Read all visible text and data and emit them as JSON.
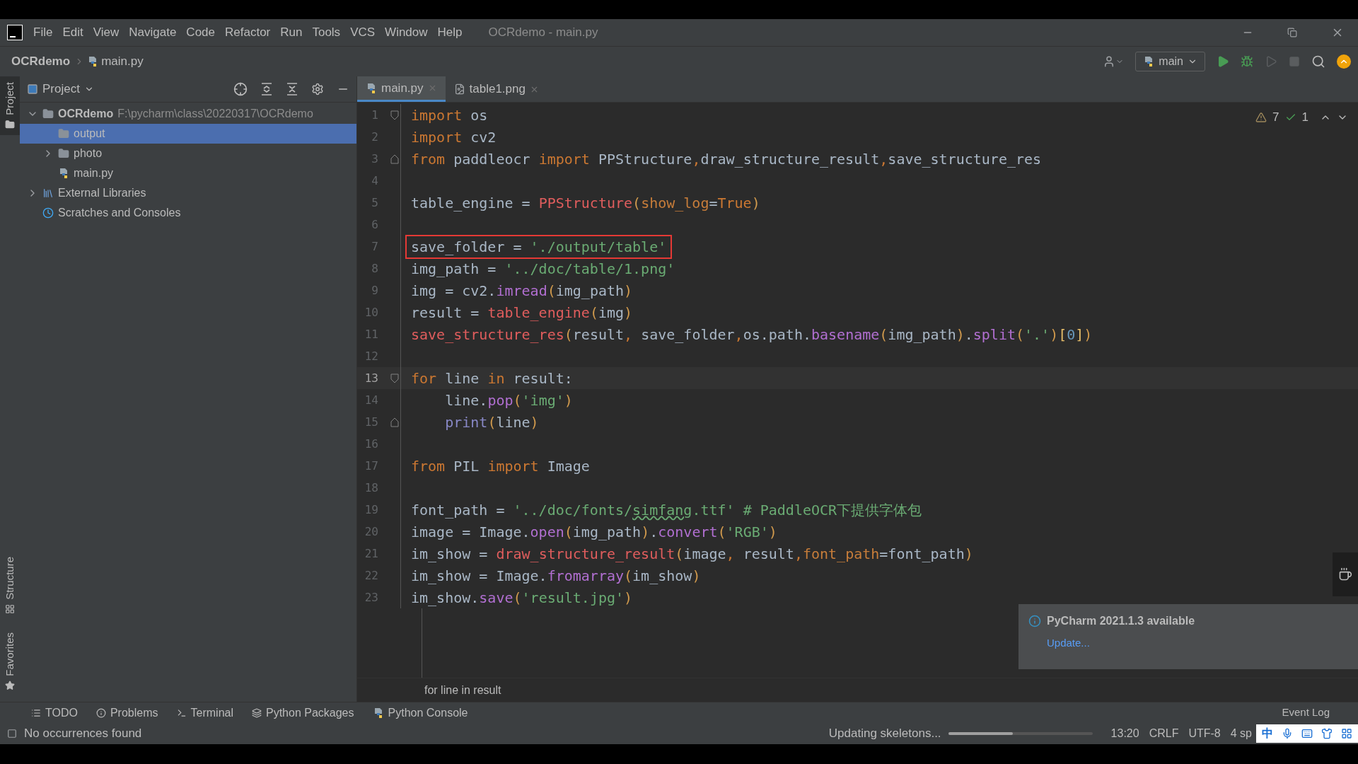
{
  "window": {
    "title": "OCRdemo - main.py"
  },
  "menu": [
    "File",
    "Edit",
    "View",
    "Navigate",
    "Code",
    "Refactor",
    "Run",
    "Tools",
    "VCS",
    "Window",
    "Help"
  ],
  "breadcrumb": [
    {
      "label": "OCRdemo",
      "kind": "project"
    },
    {
      "label": "main.py",
      "kind": "python"
    }
  ],
  "toolbar": {
    "run_config": "main"
  },
  "left_stripe": [
    {
      "label": "Project",
      "selected": true
    },
    {
      "label": "Structure",
      "selected": false
    },
    {
      "label": "Favorites",
      "selected": false
    }
  ],
  "project_panel": {
    "title": "Project",
    "tree": [
      {
        "label": "OCRdemo",
        "path": "F:\\pycharm\\class\\20220317\\OCRdemo",
        "kind": "folder",
        "expanded": true,
        "selected": false,
        "children": [
          {
            "label": "output",
            "kind": "folder",
            "selected": true
          },
          {
            "label": "photo",
            "kind": "folder",
            "expanded": false,
            "selected": false
          },
          {
            "label": "main.py",
            "kind": "python",
            "selected": false
          }
        ]
      },
      {
        "label": "External Libraries",
        "kind": "library",
        "expanded": false,
        "selected": false
      },
      {
        "label": "Scratches and Consoles",
        "kind": "scratch",
        "selected": false
      }
    ]
  },
  "tabs": [
    {
      "label": "main.py",
      "kind": "python",
      "selected": true
    },
    {
      "label": "table1.png",
      "kind": "image",
      "selected": false
    }
  ],
  "inspections": {
    "warnings": "7",
    "typos": "1"
  },
  "editor": {
    "lines": [
      {
        "number": "1",
        "kind": "fold_start",
        "current": false,
        "boxed": false,
        "tokens": [
          {
            "kind": "kw",
            "text": "import"
          },
          {
            "kind": "plain",
            "text": " os"
          }
        ]
      },
      {
        "number": "2",
        "kind": "code",
        "current": false,
        "boxed": false,
        "tokens": [
          {
            "kind": "kw",
            "text": "import"
          },
          {
            "kind": "plain",
            "text": " cv2"
          }
        ]
      },
      {
        "number": "3",
        "kind": "fold_end",
        "current": false,
        "boxed": false,
        "tokens": [
          {
            "kind": "kw",
            "text": "from"
          },
          {
            "kind": "plain",
            "text": " paddleocr "
          },
          {
            "kind": "kw",
            "text": "import"
          },
          {
            "kind": "plain",
            "text": " PPStructure"
          },
          {
            "kind": "kw",
            "text": ","
          },
          {
            "kind": "plain",
            "text": "draw_structure_result"
          },
          {
            "kind": "kw",
            "text": ","
          },
          {
            "kind": "plain",
            "text": "save_structure_res"
          }
        ]
      },
      {
        "number": "4",
        "kind": "code",
        "current": false
      },
      {
        "number": "5",
        "kind": "code",
        "current": false,
        "boxed": false,
        "tokens": [
          {
            "kind": "plain",
            "text": "table_engine = "
          },
          {
            "kind": "call",
            "text": "PPStructure"
          },
          {
            "kind": "br",
            "text": "("
          },
          {
            "kind": "param",
            "text": "show_log"
          },
          {
            "kind": "plain",
            "text": "="
          },
          {
            "kind": "kw",
            "text": "True"
          },
          {
            "kind": "br",
            "text": ")"
          }
        ]
      },
      {
        "number": "6",
        "kind": "code",
        "current": false
      },
      {
        "number": "7",
        "kind": "code",
        "current": false,
        "boxed": true,
        "tokens": [
          {
            "kind": "plain",
            "text": "save_folder = "
          },
          {
            "kind": "str",
            "text": "'./output/table'"
          }
        ]
      },
      {
        "number": "8",
        "kind": "code",
        "current": false,
        "boxed": false,
        "tokens": [
          {
            "kind": "plain",
            "text": "img_path = "
          },
          {
            "kind": "str",
            "text": "'../doc/table/1.png'"
          }
        ]
      },
      {
        "number": "9",
        "kind": "code",
        "current": false,
        "boxed": false,
        "tokens": [
          {
            "kind": "plain",
            "text": "img = cv2."
          },
          {
            "kind": "method",
            "text": "imread"
          },
          {
            "kind": "br",
            "text": "("
          },
          {
            "kind": "plain",
            "text": "img_path"
          },
          {
            "kind": "br",
            "text": ")"
          }
        ]
      },
      {
        "number": "10",
        "kind": "code",
        "current": false,
        "boxed": false,
        "tokens": [
          {
            "kind": "plain",
            "text": "result = "
          },
          {
            "kind": "call",
            "text": "table_engine"
          },
          {
            "kind": "br",
            "text": "("
          },
          {
            "kind": "plain",
            "text": "img"
          },
          {
            "kind": "br",
            "text": ")"
          }
        ]
      },
      {
        "number": "11",
        "kind": "code",
        "current": false,
        "boxed": false,
        "tokens": [
          {
            "kind": "call",
            "text": "save_structure_res"
          },
          {
            "kind": "br",
            "text": "("
          },
          {
            "kind": "plain",
            "text": "result"
          },
          {
            "kind": "kw",
            "text": ","
          },
          {
            "kind": "plain",
            "text": " save_folder"
          },
          {
            "kind": "kw",
            "text": ","
          },
          {
            "kind": "plain",
            "text": "os.path."
          },
          {
            "kind": "method",
            "text": "basename"
          },
          {
            "kind": "br",
            "text": "("
          },
          {
            "kind": "plain",
            "text": "img_path"
          },
          {
            "kind": "br",
            "text": ")"
          },
          {
            "kind": "plain",
            "text": "."
          },
          {
            "kind": "method",
            "text": "split"
          },
          {
            "kind": "br",
            "text": "("
          },
          {
            "kind": "str",
            "text": "'.'"
          },
          {
            "kind": "br",
            "text": ")"
          },
          {
            "kind": "br2",
            "text": "["
          },
          {
            "kind": "num",
            "text": "0"
          },
          {
            "kind": "br2",
            "text": "]"
          },
          {
            "kind": "br",
            "text": ")"
          }
        ]
      },
      {
        "number": "12",
        "kind": "code",
        "current": false
      },
      {
        "number": "13",
        "kind": "fold_start",
        "current": true,
        "boxed": false,
        "tokens": [
          {
            "kind": "kw",
            "text": "for"
          },
          {
            "kind": "plain",
            "text": " line "
          },
          {
            "kind": "kw",
            "text": "in"
          },
          {
            "kind": "plain",
            "text": " result:"
          }
        ]
      },
      {
        "number": "14",
        "kind": "code",
        "current": false,
        "boxed": false,
        "tokens": [
          {
            "kind": "plain",
            "text": "    line."
          },
          {
            "kind": "method",
            "text": "pop"
          },
          {
            "kind": "br",
            "text": "("
          },
          {
            "kind": "str",
            "text": "'img'"
          },
          {
            "kind": "br",
            "text": ")"
          }
        ]
      },
      {
        "number": "15",
        "kind": "fold_end",
        "current": false,
        "boxed": false,
        "tokens": [
          {
            "kind": "builtin",
            "text": "    print"
          },
          {
            "kind": "br",
            "text": "("
          },
          {
            "kind": "plain",
            "text": "line"
          },
          {
            "kind": "br",
            "text": ")"
          }
        ]
      },
      {
        "number": "16",
        "kind": "code",
        "current": false
      },
      {
        "number": "17",
        "kind": "code",
        "current": false,
        "boxed": false,
        "tokens": [
          {
            "kind": "kw",
            "text": "from"
          },
          {
            "kind": "plain",
            "text": " PIL "
          },
          {
            "kind": "kw",
            "text": "import"
          },
          {
            "kind": "plain",
            "text": " Image"
          }
        ]
      },
      {
        "number": "18",
        "kind": "code",
        "current": false
      },
      {
        "number": "19",
        "kind": "code",
        "current": false,
        "boxed": false,
        "tokens": [
          {
            "kind": "plain",
            "text": "font_path = "
          },
          {
            "kind": "str",
            "text": "'../doc/fonts/"
          },
          {
            "kind": "typo",
            "text": "simfang"
          },
          {
            "kind": "str",
            "text": ".ttf'"
          },
          {
            "kind": "comment",
            "text": " # PaddleOCR下提供字体包"
          }
        ]
      },
      {
        "number": "20",
        "kind": "code",
        "current": false,
        "boxed": false,
        "tokens": [
          {
            "kind": "plain",
            "text": "image = Image."
          },
          {
            "kind": "method",
            "text": "open"
          },
          {
            "kind": "br",
            "text": "("
          },
          {
            "kind": "plain",
            "text": "img_path"
          },
          {
            "kind": "br",
            "text": ")"
          },
          {
            "kind": "plain",
            "text": "."
          },
          {
            "kind": "method",
            "text": "convert"
          },
          {
            "kind": "br",
            "text": "("
          },
          {
            "kind": "str",
            "text": "'RGB'"
          },
          {
            "kind": "br",
            "text": ")"
          }
        ]
      },
      {
        "number": "21",
        "kind": "code",
        "current": false,
        "boxed": false,
        "tokens": [
          {
            "kind": "plain",
            "text": "im_show = "
          },
          {
            "kind": "call",
            "text": "draw_structure_result"
          },
          {
            "kind": "br",
            "text": "("
          },
          {
            "kind": "plain",
            "text": "image"
          },
          {
            "kind": "kw",
            "text": ","
          },
          {
            "kind": "plain",
            "text": " result"
          },
          {
            "kind": "kw",
            "text": ","
          },
          {
            "kind": "param",
            "text": "font_path"
          },
          {
            "kind": "plain",
            "text": "=font_path"
          },
          {
            "kind": "br",
            "text": ")"
          }
        ]
      },
      {
        "number": "22",
        "kind": "code",
        "current": false,
        "boxed": false,
        "tokens": [
          {
            "kind": "plain",
            "text": "im_show = Image."
          },
          {
            "kind": "method",
            "text": "fromarray"
          },
          {
            "kind": "br",
            "text": "("
          },
          {
            "kind": "plain",
            "text": "im_show"
          },
          {
            "kind": "br",
            "text": ")"
          }
        ]
      },
      {
        "number": "23",
        "kind": "code",
        "current": false,
        "boxed": false,
        "tokens": [
          {
            "kind": "plain",
            "text": "im_show."
          },
          {
            "kind": "method",
            "text": "save"
          },
          {
            "kind": "br",
            "text": "("
          },
          {
            "kind": "str",
            "text": "'result.jpg'"
          },
          {
            "kind": "br",
            "text": ")"
          }
        ]
      }
    ],
    "breadcrumb": "for line in result"
  },
  "notification": {
    "title": "PyCharm 2021.1.3 available",
    "link": "Update..."
  },
  "tool_tabs": [
    {
      "label": "TODO",
      "kind": "todo"
    },
    {
      "label": "Problems",
      "kind": "problems"
    },
    {
      "label": "Terminal",
      "kind": "terminal"
    },
    {
      "label": "Python Packages",
      "kind": "packages"
    },
    {
      "label": "Python Console",
      "kind": "console"
    }
  ],
  "status_bar": {
    "message": "No occurrences found",
    "progress_label": "Updating skeletons...",
    "progress": {
      "level": 0.45
    },
    "items": [
      "13:20",
      "CRLF",
      "UTF-8",
      "4 sp"
    ],
    "event_log": "Event Log",
    "ime": "中"
  }
}
